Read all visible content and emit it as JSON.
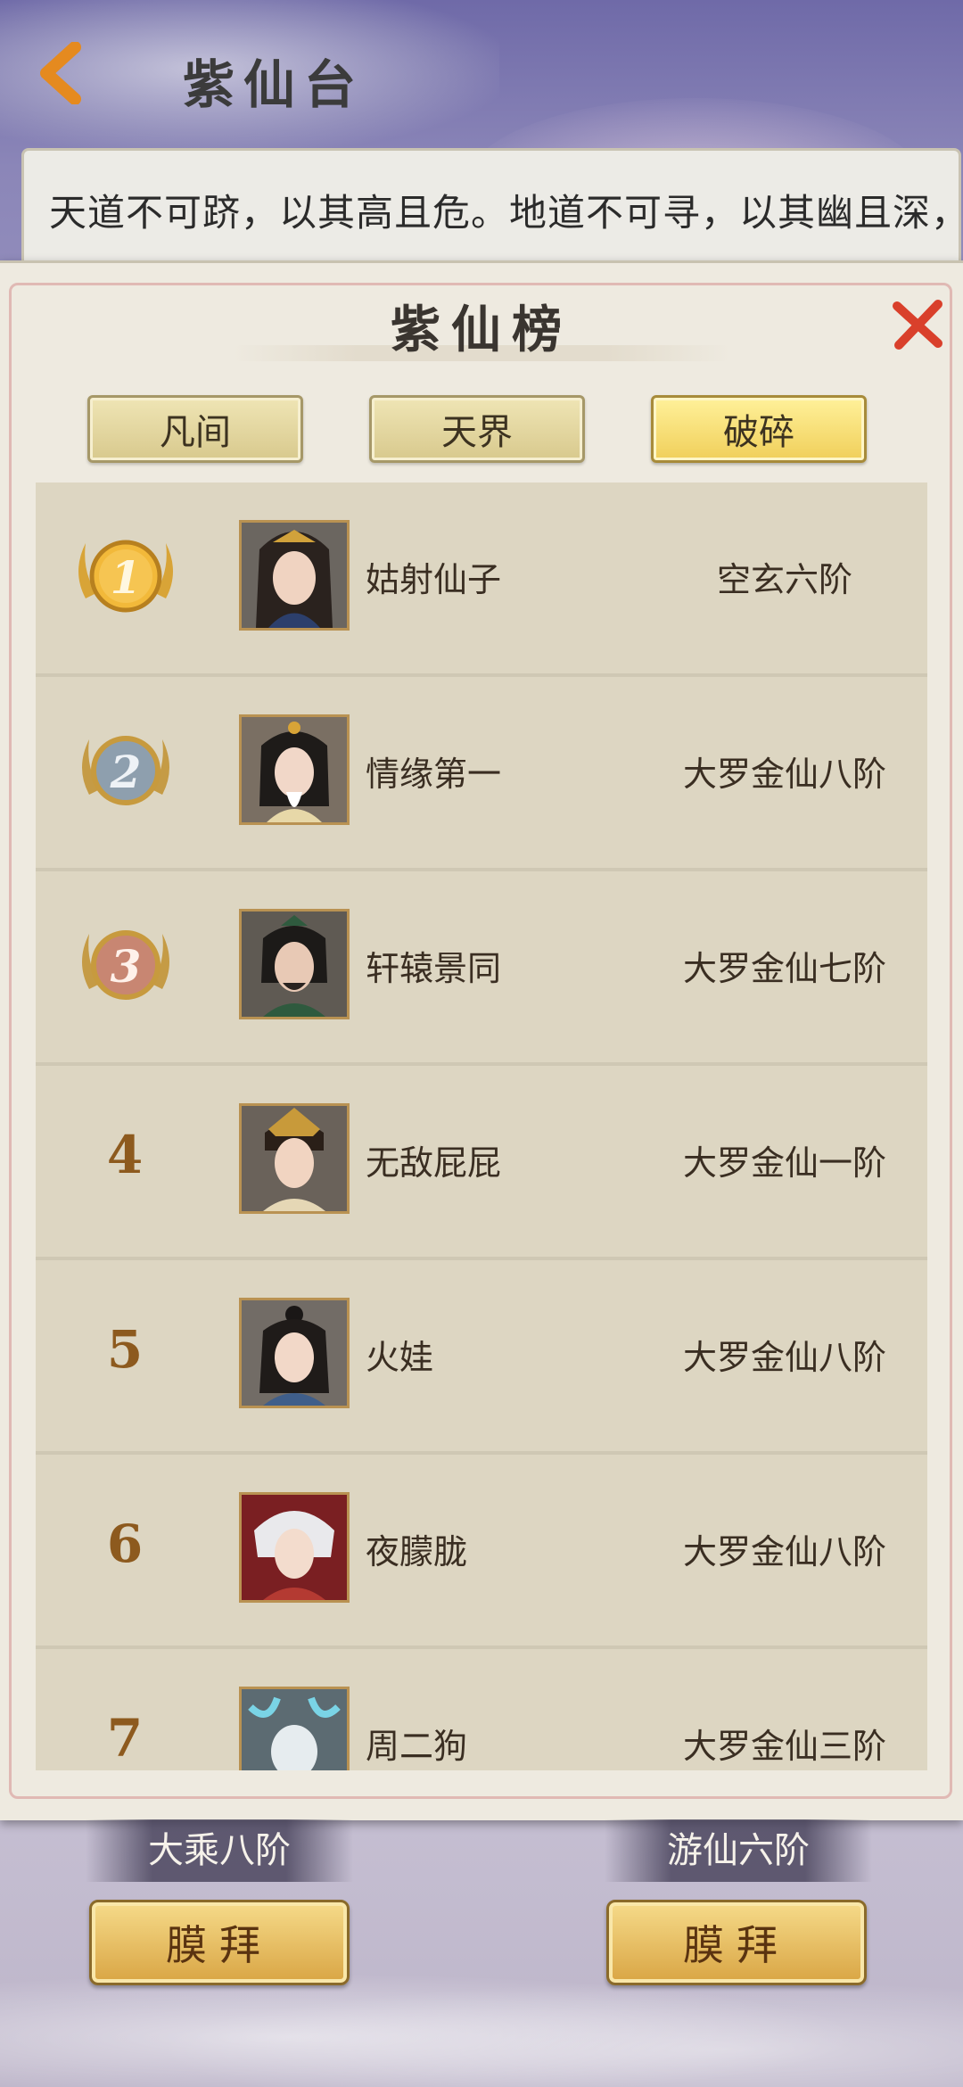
{
  "header": {
    "title": "紫仙台",
    "back_icon": "chevron-left-icon"
  },
  "description": {
    "text": "天道不可跻，以其高且危。地道不可寻，以其幽且深，求道者无数，如果道化有成，泪将耀之，但秉"
  },
  "panel": {
    "title": "紫仙榜",
    "close_icon": "close-icon",
    "tabs": [
      {
        "label": "凡间",
        "active": false
      },
      {
        "label": "天界",
        "active": false
      },
      {
        "label": "破碎",
        "active": true
      }
    ],
    "rows": [
      {
        "rank": "1",
        "medal": "gold",
        "name": "姑射仙子",
        "realm": "空玄六阶"
      },
      {
        "rank": "2",
        "medal": "silver",
        "name": "情缘第一",
        "realm": "大罗金仙八阶"
      },
      {
        "rank": "3",
        "medal": "bronze",
        "name": "轩辕景同",
        "realm": "大罗金仙七阶"
      },
      {
        "rank": "4",
        "medal": "",
        "name": "无敌屁屁",
        "realm": "大罗金仙一阶"
      },
      {
        "rank": "5",
        "medal": "",
        "name": "火娃",
        "realm": "大罗金仙八阶"
      },
      {
        "rank": "6",
        "medal": "",
        "name": "夜朦胧",
        "realm": "大罗金仙八阶"
      },
      {
        "rank": "7",
        "medal": "",
        "name": "周二狗",
        "realm": "大罗金仙三阶"
      }
    ]
  },
  "bottom": {
    "left_label": "大乘八阶",
    "right_label": "游仙六阶",
    "worship_label": "膜拜"
  },
  "colors": {
    "gold": "#f2b93a",
    "silver": "#8e9fae",
    "bronze": "#c88672",
    "rank_text": "#8d5a1e"
  }
}
